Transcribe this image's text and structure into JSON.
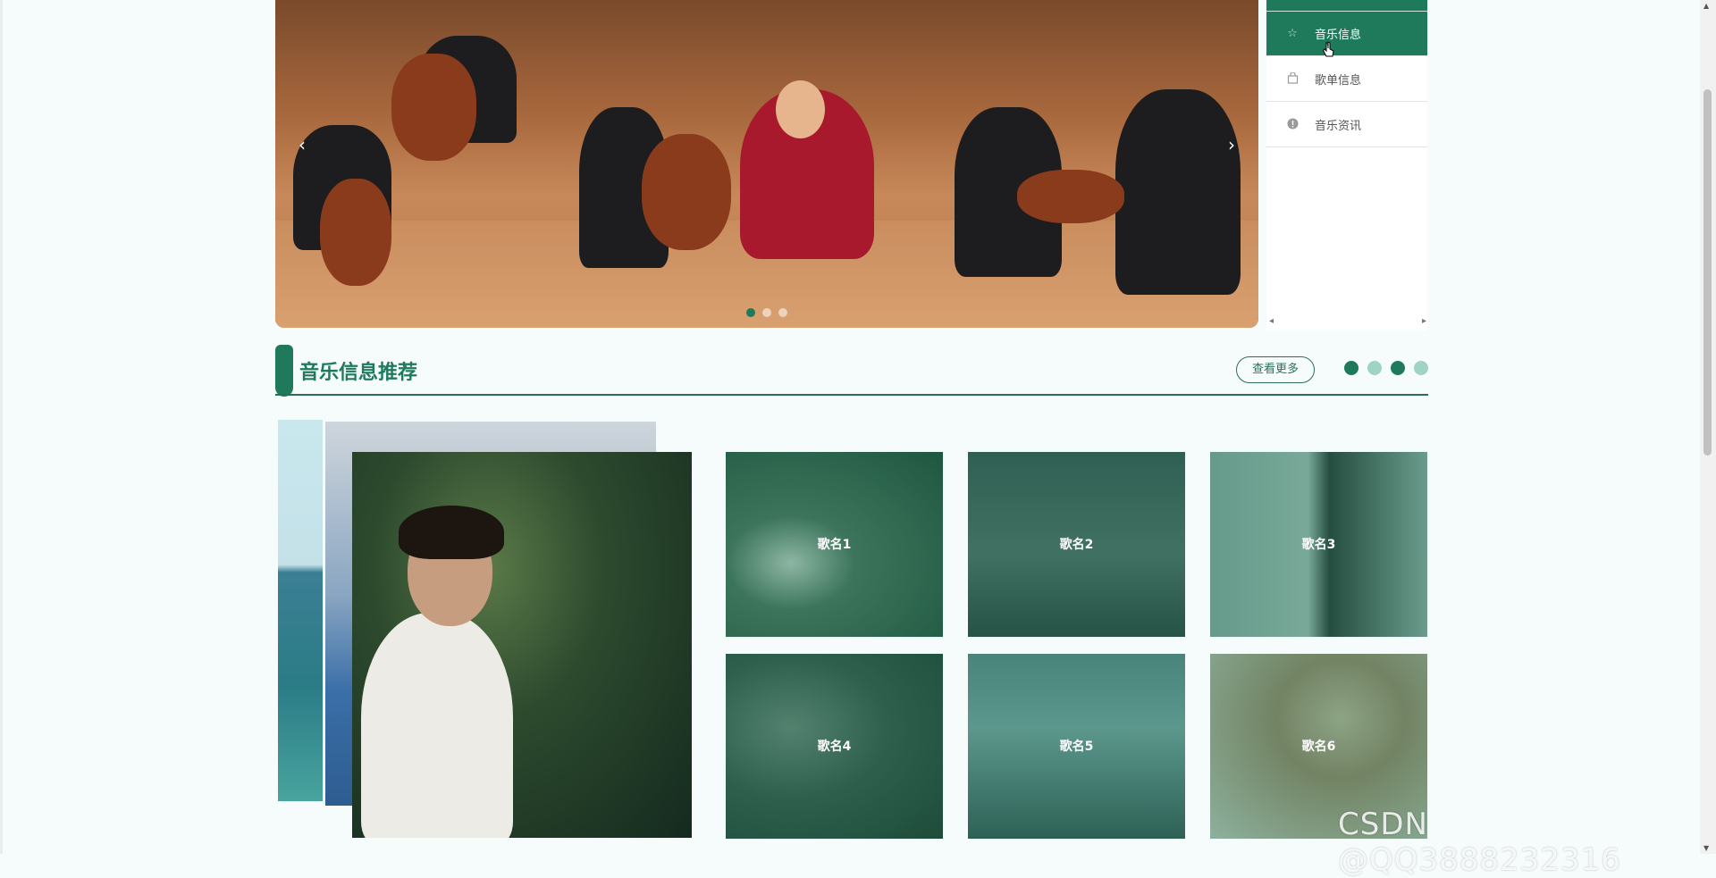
{
  "carousel": {
    "prev_label": "‹",
    "next_label": "›",
    "slides": 3,
    "active_slide": 1
  },
  "side_menu": {
    "items": [
      {
        "label": "音乐信息",
        "icon": "star-icon",
        "active": true
      },
      {
        "label": "歌单信息",
        "icon": "bag-icon",
        "active": false
      },
      {
        "label": "音乐资讯",
        "icon": "info-icon",
        "active": false
      }
    ],
    "scroll_left": "◂",
    "scroll_right": "▸"
  },
  "section": {
    "title": "音乐信息推荐",
    "more_label": "查看更多",
    "dots": [
      {
        "color": "#1e7a5a"
      },
      {
        "color": "#9fd3c4"
      },
      {
        "color": "#1e7a5a"
      },
      {
        "color": "#9fd3c4"
      }
    ]
  },
  "songs": [
    {
      "label": "歌名1"
    },
    {
      "label": "歌名2"
    },
    {
      "label": "歌名3"
    },
    {
      "label": "歌名4"
    },
    {
      "label": "歌名5"
    },
    {
      "label": "歌名6"
    }
  ],
  "watermark": "CSDN @QQ3888232316",
  "colors": {
    "accent": "#1e7a5a",
    "background": "#f6fcfc"
  }
}
